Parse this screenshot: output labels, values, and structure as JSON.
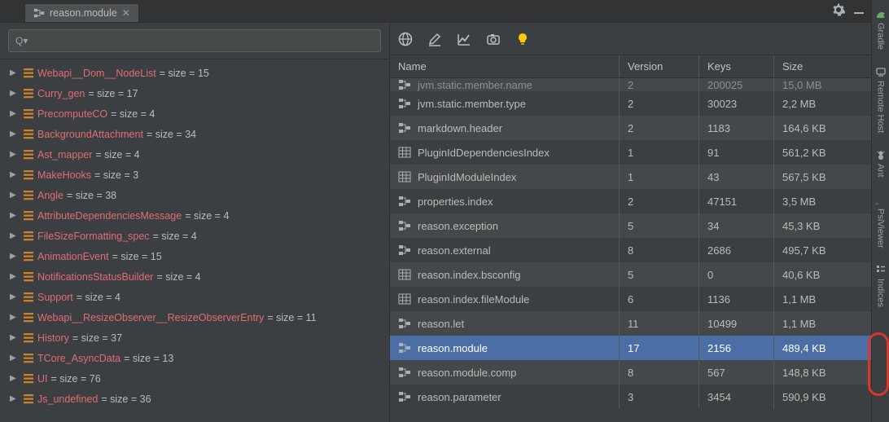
{
  "tab": {
    "label": "reason.module"
  },
  "search": {
    "placeholder": ""
  },
  "tree": [
    {
      "name": "Webapi__Dom__NodeList",
      "size": 15
    },
    {
      "name": "Curry_gen",
      "size": 17
    },
    {
      "name": "PrecomputeCO",
      "size": 4
    },
    {
      "name": "BackgroundAttachment",
      "size": 34
    },
    {
      "name": "Ast_mapper",
      "size": 4
    },
    {
      "name": "MakeHooks",
      "size": 3
    },
    {
      "name": "Angle",
      "size": 38
    },
    {
      "name": "AttributeDependenciesMessage",
      "size": 4
    },
    {
      "name": "FileSizeFormatting_spec",
      "size": 4
    },
    {
      "name": "AnimationEvent",
      "size": 15
    },
    {
      "name": "NotificationsStatusBuilder",
      "size": 4
    },
    {
      "name": "Support",
      "size": 4
    },
    {
      "name": "Webapi__ResizeObserver__ResizeObserverEntry",
      "size": 11
    },
    {
      "name": "History",
      "size": 37
    },
    {
      "name": "TCore_AsyncData",
      "size": 13
    },
    {
      "name": "UI",
      "size": 76
    },
    {
      "name": "Js_undefined",
      "size": 36
    }
  ],
  "table": {
    "headers": {
      "name": "Name",
      "version": "Version",
      "keys": "Keys",
      "size": "Size"
    },
    "rows": [
      {
        "icon": "tree",
        "name": "jvm.static.member.name",
        "version": "2",
        "keys": "200025",
        "size": "15,0 MB",
        "clipped": true
      },
      {
        "icon": "tree",
        "name": "jvm.static.member.type",
        "version": "2",
        "keys": "30023",
        "size": "2,2 MB"
      },
      {
        "icon": "tree",
        "name": "markdown.header",
        "version": "2",
        "keys": "1183",
        "size": "164,6 KB"
      },
      {
        "icon": "grid",
        "name": "PluginIdDependenciesIndex",
        "version": "1",
        "keys": "91",
        "size": "561,2 KB"
      },
      {
        "icon": "grid",
        "name": "PluginIdModuleIndex",
        "version": "1",
        "keys": "43",
        "size": "567,5 KB"
      },
      {
        "icon": "tree",
        "name": "properties.index",
        "version": "2",
        "keys": "47151",
        "size": "3,5 MB"
      },
      {
        "icon": "tree",
        "name": "reason.exception",
        "version": "5",
        "keys": "34",
        "size": "45,3 KB"
      },
      {
        "icon": "tree",
        "name": "reason.external",
        "version": "8",
        "keys": "2686",
        "size": "495,7 KB"
      },
      {
        "icon": "grid",
        "name": "reason.index.bsconfig",
        "version": "5",
        "keys": "0",
        "size": "40,6 KB"
      },
      {
        "icon": "grid",
        "name": "reason.index.fileModule",
        "version": "6",
        "keys": "1136",
        "size": "1,1 MB"
      },
      {
        "icon": "tree",
        "name": "reason.let",
        "version": "11",
        "keys": "10499",
        "size": "1,1 MB"
      },
      {
        "icon": "tree",
        "name": "reason.module",
        "version": "17",
        "keys": "2156",
        "size": "489,4 KB",
        "selected": true
      },
      {
        "icon": "tree",
        "name": "reason.module.comp",
        "version": "8",
        "keys": "567",
        "size": "148,8 KB"
      },
      {
        "icon": "tree",
        "name": "reason.parameter",
        "version": "3",
        "keys": "3454",
        "size": "590,9 KB"
      }
    ]
  },
  "sidebar": [
    {
      "id": "gradle",
      "label": "Gradle"
    },
    {
      "id": "remotehost",
      "label": "Remote Host"
    },
    {
      "id": "ant",
      "label": "Ant"
    },
    {
      "id": "psiviewer",
      "label": "PsiViewer"
    },
    {
      "id": "indices",
      "label": "Indices"
    }
  ]
}
